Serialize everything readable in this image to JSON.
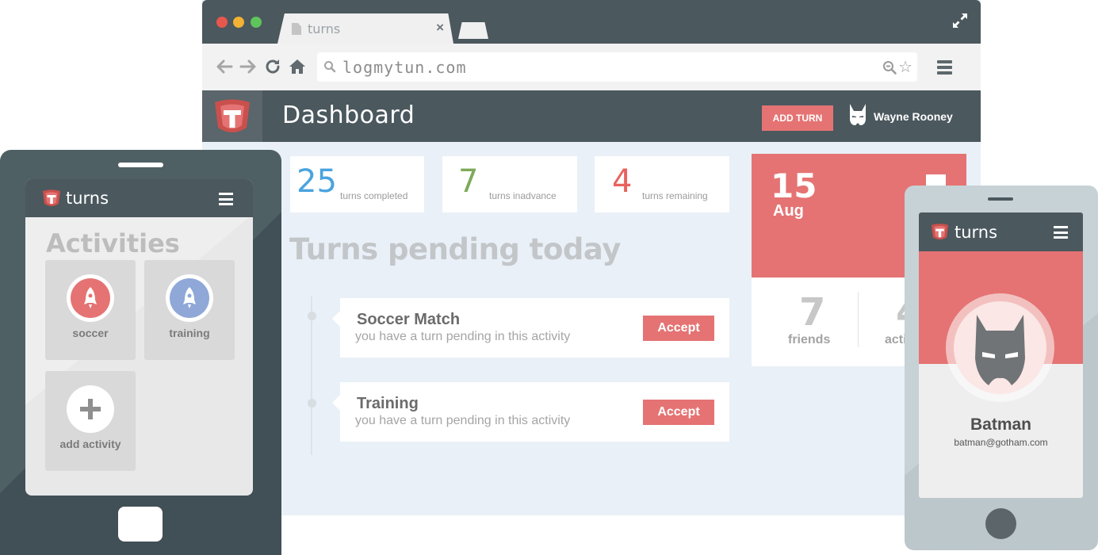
{
  "browser": {
    "tab_title": "turns",
    "tab_close": "×",
    "url": "logmytun.com"
  },
  "app": {
    "page_title": "Dashboard",
    "add_turn_label": "ADD TURN",
    "user_name": "Wayne Rooney",
    "stats": [
      {
        "value": "25",
        "label": "turns completed",
        "color": "#4aa3df"
      },
      {
        "value": "7",
        "label": "turns inadvance",
        "color": "#7daa5a"
      },
      {
        "value": "4",
        "label": "turns remaining",
        "color": "#e8625e"
      }
    ],
    "section_title": "Turns pending today",
    "turns": [
      {
        "title": "Soccer Match",
        "subtitle": "you have a turn pending in this activity",
        "action": "Accept"
      },
      {
        "title": "Training",
        "subtitle": "you have a turn pending in this activity",
        "action": "Accept"
      }
    ],
    "date": {
      "day": "15",
      "month": "Aug"
    },
    "friends": {
      "value": "7",
      "label": "friends"
    },
    "activities_stat": {
      "value": "4",
      "label": "activities"
    }
  },
  "tablet": {
    "brand": "turns",
    "title": "Activities",
    "activities": [
      {
        "name": "soccer",
        "color": "#e57373"
      },
      {
        "name": "training",
        "color": "#8fa8d8"
      },
      {
        "name": "add activity",
        "color": "#ffffff"
      }
    ]
  },
  "phone": {
    "brand": "turns",
    "profile_name": "Batman",
    "profile_email": "batman@gotham.com"
  },
  "colors": {
    "accent": "#e57373",
    "header": "#4b585e",
    "background": "#e9f0f7"
  }
}
